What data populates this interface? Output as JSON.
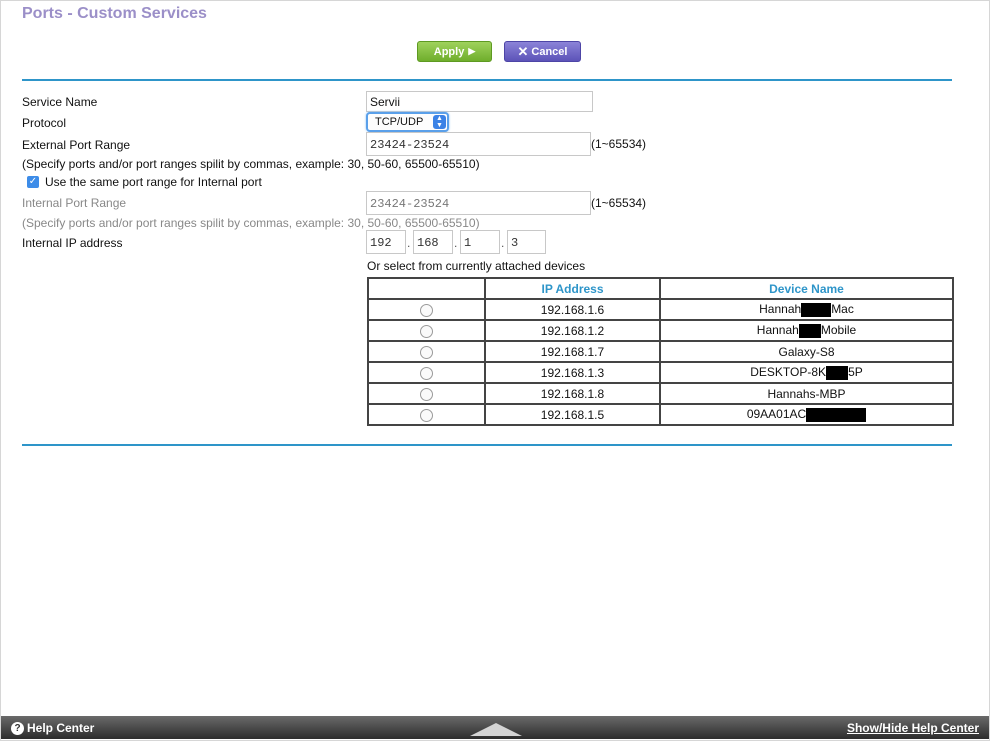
{
  "page": {
    "title": "Ports - Custom Services"
  },
  "toolbar": {
    "apply_label": "Apply",
    "cancel_label": "Cancel"
  },
  "form": {
    "service_name": {
      "label": "Service Name",
      "value": "Servii"
    },
    "protocol": {
      "label": "Protocol",
      "value": "TCP/UDP"
    },
    "external_port": {
      "label": "External Port Range",
      "value": "23424-23524",
      "range": "(1~65534)",
      "hint": "(Specify ports and/or port ranges spilit by commas, example: 30, 50-60, 65500-65510)"
    },
    "same_range": {
      "label": "Use the same port range for Internal port",
      "checked": true
    },
    "internal_port": {
      "label": "Internal Port Range",
      "value": "23424-23524",
      "range": "(1~65534)",
      "hint": "(Specify ports and/or port ranges spilit by commas, example: 30, 50-60, 65500-65510)"
    },
    "internal_ip": {
      "label": "Internal IP address",
      "octets": [
        "192",
        "168",
        "1",
        "3"
      ]
    }
  },
  "devices": {
    "caption": "Or select from currently attached devices",
    "headers": {
      "ip": "IP Address",
      "name": "Device Name"
    },
    "rows": [
      {
        "ip": "192.168.1.6",
        "name_start": "Hannah",
        "name_end": "Mac"
      },
      {
        "ip": "192.168.1.2",
        "name_start": "Hannah",
        "name_end": "Mobile"
      },
      {
        "ip": "192.168.1.7",
        "name_start": "Galaxy-S8",
        "name_end": ""
      },
      {
        "ip": "192.168.1.3",
        "name_start": "DESKTOP-8K",
        "name_end": "5P"
      },
      {
        "ip": "192.168.1.8",
        "name_start": "Hannahs-MBP",
        "name_end": ""
      },
      {
        "ip": "192.168.1.5",
        "name_start": "09AA01AC",
        "name_end": ""
      }
    ]
  },
  "footer": {
    "help_center": "Help Center",
    "toggle_help": "Show/Hide Help Center"
  },
  "colors": {
    "title": "#9b8fc8",
    "accent": "#2e95c9",
    "apply": "#7fbf3a",
    "cancel": "#6b63c6"
  }
}
